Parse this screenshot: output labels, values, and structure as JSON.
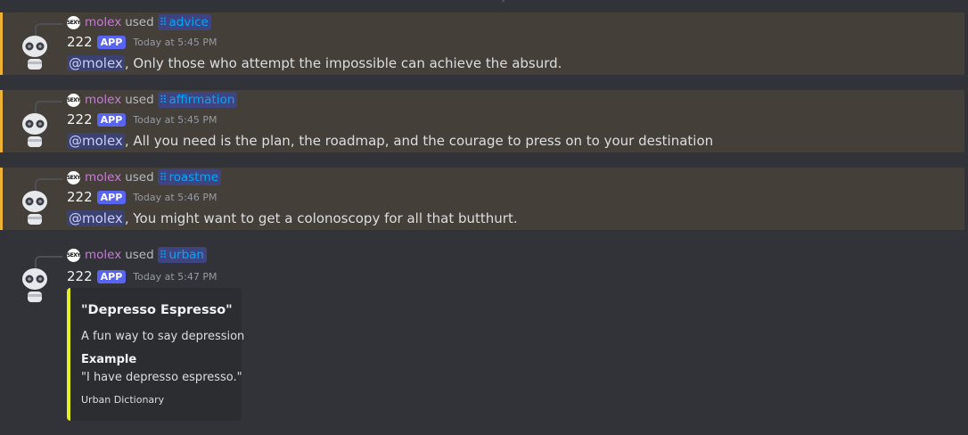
{
  "colors": {
    "background": "#313338",
    "highlight_background": "#444039",
    "highlight_bar": "#f0b232",
    "app_badge": "#5865f2",
    "command_color": "#00a8fc",
    "user_name_color": "#c67bd6",
    "embed_accent": "#e4ee24"
  },
  "messages": [
    {
      "reply_user": "molex",
      "reply_used": "used",
      "command": "advice",
      "command_icon": "slash-command-icon",
      "bot_name": "222",
      "badge": "APP",
      "timestamp": "Today at 5:45 PM",
      "mention": "@molex",
      "text": ", Only those who attempt the impossible can achieve the absurd."
    },
    {
      "reply_user": "molex",
      "reply_used": "used",
      "command": "affirmation",
      "command_icon": "slash-command-icon",
      "bot_name": "222",
      "badge": "APP",
      "timestamp": "Today at 5:45 PM",
      "mention": "@molex",
      "text": ", All you need is the plan, the roadmap, and the courage to press on to your destination"
    },
    {
      "reply_user": "molex",
      "reply_used": "used",
      "command": "roastme",
      "command_icon": "slash-command-icon",
      "bot_name": "222",
      "badge": "APP",
      "timestamp": "Today at 5:46 PM",
      "mention": "@molex",
      "text": ", You might want to get a colonoscopy for all that butthurt."
    },
    {
      "reply_user": "molex",
      "reply_used": "used",
      "command": "urban",
      "command_icon": "slash-command-icon",
      "bot_name": "222",
      "badge": "APP",
      "timestamp": "Today at 5:47 PM",
      "embed": {
        "title": "\"Depresso Espresso\"",
        "description": "A fun way to say depression",
        "field_name": "Example",
        "field_value": "\"I have depresso espresso.\"",
        "footer": "Urban Dictionary"
      }
    }
  ]
}
